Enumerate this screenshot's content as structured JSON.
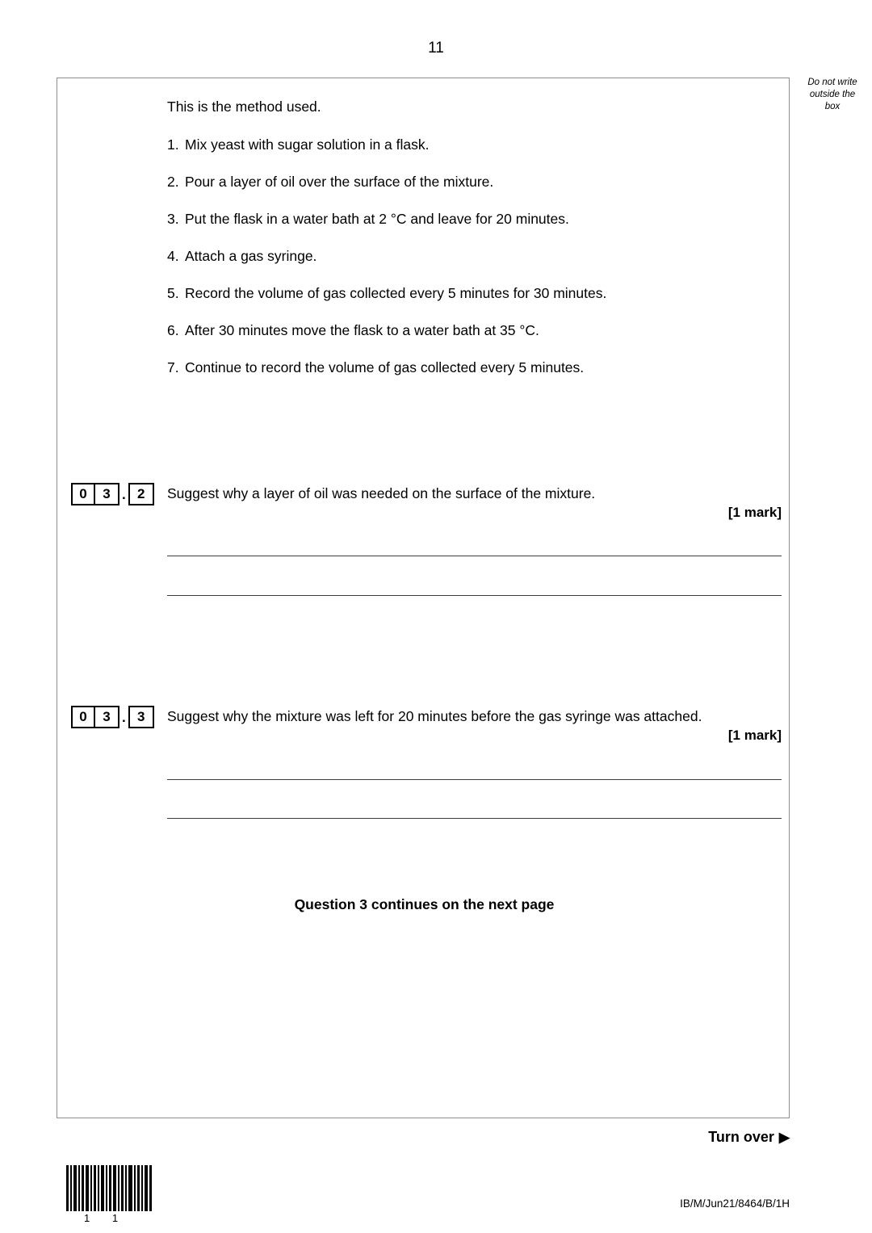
{
  "page": {
    "number": "11",
    "margin_note": "Do not write\noutside the\nbox",
    "margin_note_line1": "Do not write",
    "margin_note_line2": "outside the",
    "margin_note_line3": "box"
  },
  "method": {
    "intro": "This is the method used.",
    "steps": [
      {
        "number": "1.",
        "text": "Mix yeast with sugar solution in a flask."
      },
      {
        "number": "2.",
        "text": "Pour a layer of oil over the surface of the mixture."
      },
      {
        "number": "3.",
        "text": "Put the flask in a water bath at 2 °C and leave for 20 minutes."
      },
      {
        "number": "4.",
        "text": "Attach a gas syringe."
      },
      {
        "number": "5.",
        "text": "Record the volume of gas collected every 5 minutes for 30 minutes."
      },
      {
        "number": "6.",
        "text": "After 30 minutes move the flask to a water bath at 35 °C."
      },
      {
        "number": "7.",
        "text": "Continue to record the volume of gas collected every 5 minutes."
      }
    ]
  },
  "questions": [
    {
      "id": "03.2",
      "digit1": "0",
      "digit2": "3",
      "separator": ".",
      "digit3": "2",
      "text": "Suggest why a layer of oil was needed on the surface of the mixture.",
      "marks": "[1 mark]",
      "answer_lines": 2
    },
    {
      "id": "03.3",
      "digit1": "0",
      "digit2": "3",
      "separator": ".",
      "digit3": "3",
      "text": "Suggest why the mixture was left for 20 minutes before the gas syringe was attached.",
      "marks": "[1 mark]",
      "answer_lines": 2
    }
  ],
  "notices": {
    "continues": "Question 3 continues on the next page",
    "turn_over": "Turn over",
    "turn_over_arrow": "▶"
  },
  "footer": {
    "barcode_label": "1 1",
    "document_code": "IB/M/Jun21/8464/B/1H"
  },
  "colors": {
    "text": "#000000",
    "box_border": "#8d8d8d",
    "rule_line": "#3d3d3d",
    "background": "#ffffff"
  }
}
